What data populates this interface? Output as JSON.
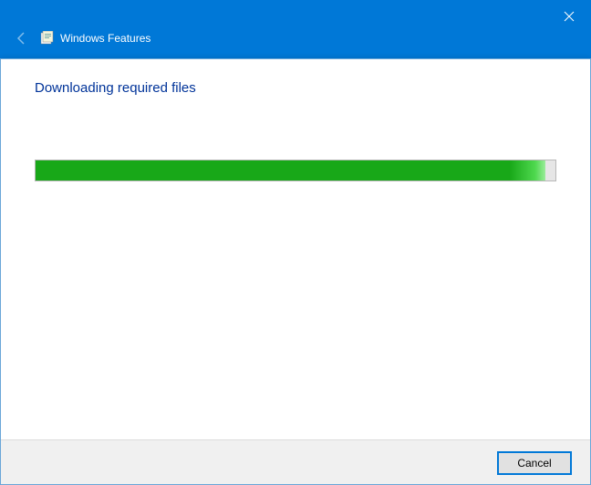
{
  "titlebar": {
    "title": "Windows Features"
  },
  "content": {
    "heading": "Downloading required files",
    "progress_percent": 98
  },
  "footer": {
    "cancel_label": "Cancel"
  },
  "colors": {
    "accent": "#0078d7",
    "heading_text": "#003399",
    "progress_fill": "#18a818"
  }
}
